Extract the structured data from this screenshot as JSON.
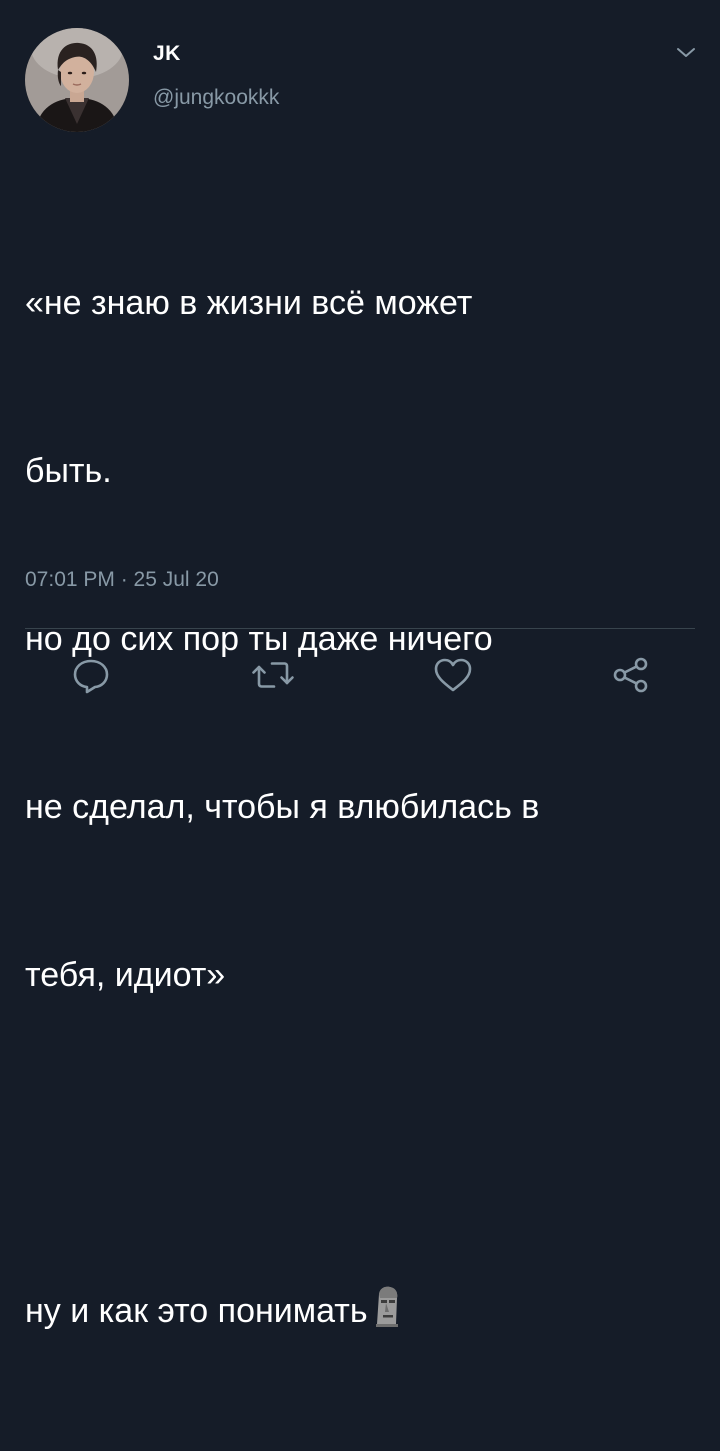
{
  "author": {
    "display_name": "JK",
    "handle": "@jungkookkk",
    "avatar": "profile-photo"
  },
  "tweet": {
    "lines": [
      "«не знаю в жизни всё может",
      "быть.",
      "но до сих пор ты даже ничего",
      "не сделал, чтобы я влюбилась в",
      "тебя, идиот»"
    ],
    "last_line": "ну и как это понимать",
    "emoji": "moai",
    "timestamp": "07:01 PM · 25 Jul 20"
  },
  "actions": [
    {
      "icon": "reply-icon"
    },
    {
      "icon": "retweet-icon"
    },
    {
      "icon": "like-icon"
    },
    {
      "icon": "share-icon"
    }
  ],
  "colors": {
    "background": "#151c28",
    "text": "#ffffff",
    "secondary": "#8899a6",
    "divider": "#38444d"
  }
}
